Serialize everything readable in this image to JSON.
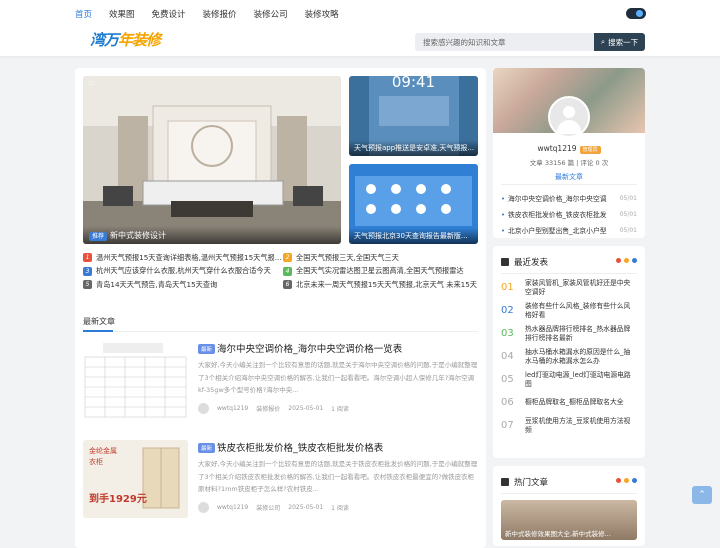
{
  "nav": {
    "items": [
      "首页",
      "效果图",
      "免费设计",
      "装修报价",
      "装修公司",
      "装修攻略"
    ],
    "active": 0
  },
  "logo": {
    "part1": "湾万",
    "part2": "年装修"
  },
  "search": {
    "placeholder": "搜索感兴趣的知识和文章",
    "button": "搜索一下"
  },
  "slider": {
    "tag": "推荐",
    "caption": "新中式装修设计"
  },
  "side_images": [
    {
      "overlay": "09:41",
      "caption": "天气预报app推送是安卓准,天气预报..."
    },
    {
      "caption": "天气预报北京30天查询报告最新版..."
    }
  ],
  "headlines": [
    {
      "n": "1",
      "text": "温州天气预报15天查询详细表格,温州天气预报15天气报...",
      "color": "#e8513a"
    },
    {
      "n": "2",
      "text": "全国天气预报三天,全国天气三天",
      "color": "#f5a623"
    },
    {
      "n": "3",
      "text": "杭州天气应该穿什么衣服,杭州天气穿什么衣服合适今天",
      "color": "#3a7bd5"
    },
    {
      "n": "4",
      "text": "全国天气实况雷达图卫星云图高清,全国天气预报雷达",
      "color": "#5bb85b"
    },
    {
      "n": "5",
      "text": "青岛14天天气预告,青岛天气15天查询",
      "color": "#666666"
    },
    {
      "n": "6",
      "text": "北京未来一周天气预报15天天气预报,北京天气 未来15天",
      "color": "#666666"
    }
  ],
  "latest": {
    "title": "最新文章"
  },
  "articles": [
    {
      "tag": "最新",
      "title": "海尔中央空调价格_海尔中央空调价格一览表",
      "desc": "大家好,今天小编关注到一个比较有意思的话题,就是关于海尔中央空调价格的问题,于是小编就整理了3个相关介绍海尔中央空调价格的解答,让我们一起看看吧。海尔空调小超人保修几年?海尔空调kf-35gw多个型号价格?海尔中央...",
      "author": "wwtq1219",
      "category": "装修报价",
      "date": "2025-05-01",
      "reads": "1 阅读"
    },
    {
      "tag": "最新",
      "title": "铁皮衣柜批发价格_铁皮衣柜批发价格表",
      "desc": "大家好,今天小编关注到一个比较有意思的话题,就是关于铁皮衣柜批发价格的问题,于是小编就整理了3个相关介绍铁皮衣柜批发价格的解答,让我们一起看看吧。农村铁皮衣柜最便宜的?做铁皮衣柜原材料?1mm铁皮柜子怎么样?农村铁皮...",
      "author": "wwtq1219",
      "category": "装修公司",
      "date": "2025-05-01",
      "reads": "1 阅读"
    }
  ],
  "thumb2": {
    "line1": "金纶金属",
    "line2": "衣柜",
    "price": "到手1929元"
  },
  "profile": {
    "name": "wwtq1219",
    "badge": "管理员",
    "stats": "文章 33156 篇 | 评论 0 次",
    "news_title": "最新文章",
    "items": [
      {
        "text": "海尔中央空调价格_海尔中央空调价格...",
        "date": "05/01"
      },
      {
        "text": "铁皮衣柜批发价格_铁皮衣柜批发...",
        "date": "05/01"
      },
      {
        "text": "北京小户型别墅出售_北京小户型...",
        "date": "05/01"
      }
    ]
  },
  "recent": {
    "title": "最近发表",
    "items": [
      {
        "n": "01",
        "text": "家装风管机_家装风管机好还是中央空调好",
        "color": "#f5a623"
      },
      {
        "n": "02",
        "text": "装修有些什么风格_装修有些什么风格好看",
        "color": "#3a7bd5"
      },
      {
        "n": "03",
        "text": "热水器品牌排行榜排名_热水器品牌排行榜排名最新",
        "color": "#5bb85b"
      },
      {
        "n": "04",
        "text": "抽水马桶水箱漏水的原因是什么_抽水马桶的水箱漏水怎么办",
        "color": "#aaaaaa"
      },
      {
        "n": "05",
        "text": "led灯驱动电源_led灯驱动电源电路图",
        "color": "#aaaaaa"
      },
      {
        "n": "06",
        "text": "橱柜品牌取名_橱柜品牌取名大全",
        "color": "#aaaaaa"
      },
      {
        "n": "07",
        "text": "豆浆机使用方法_豆浆机使用方法视频",
        "color": "#aaaaaa"
      }
    ]
  },
  "hot": {
    "title": "热门文章",
    "caption": "新中式装修效果图大全,新中式装修..."
  },
  "colors": {
    "accent": "#2b7bdb",
    "dot1": "#e8513a",
    "dot2": "#f5a623",
    "dot3": "#3a7bd5"
  }
}
